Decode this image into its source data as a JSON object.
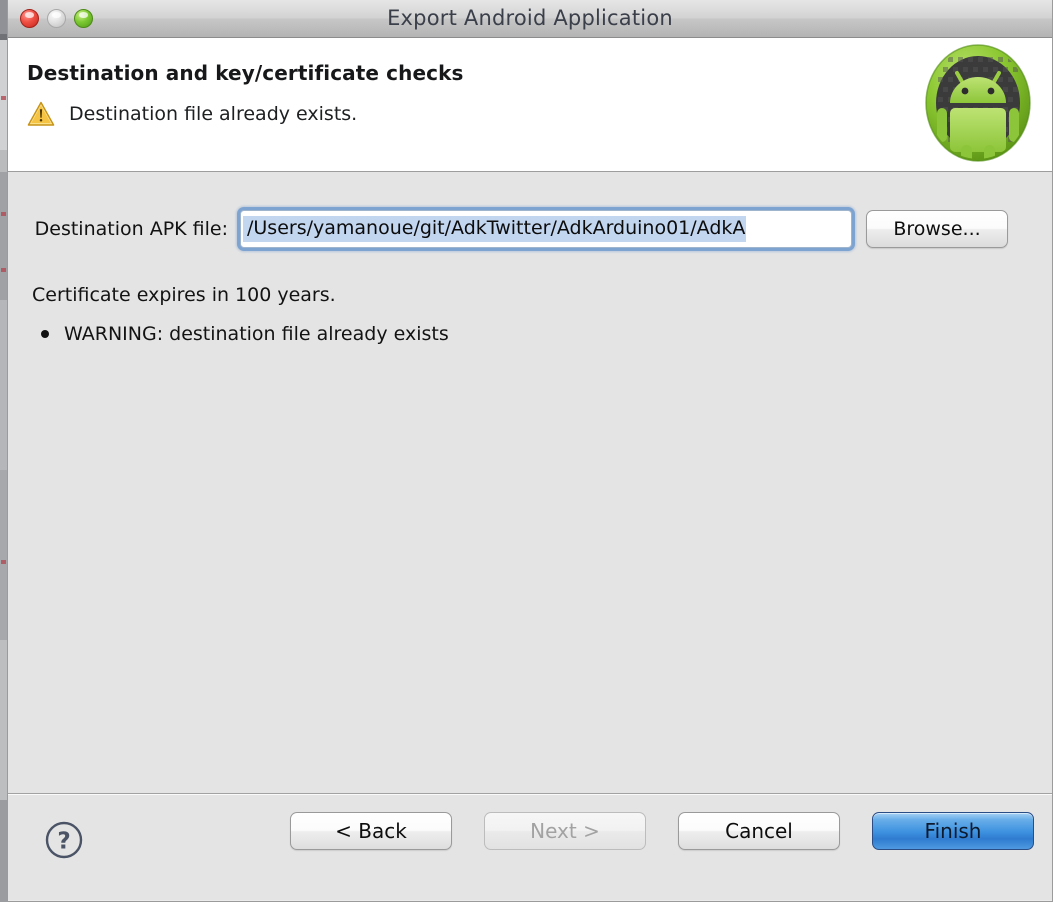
{
  "window": {
    "title": "Export Android Application",
    "controls": [
      {
        "name": "close",
        "state": "enabled"
      },
      {
        "name": "minimize",
        "state": "disabled"
      },
      {
        "name": "zoom",
        "state": "enabled"
      }
    ]
  },
  "header": {
    "title": "Destination and key/certificate checks",
    "message": "Destination file already exists.",
    "message_icon": "warning-triangle-icon",
    "brand_icon": "android-robot-icon"
  },
  "form": {
    "destination_label": "Destination APK file:",
    "destination_value": "/Users/yamanoue/git/AdkTwitter/AdkArduino01/AdkA",
    "destination_placeholder": "",
    "browse_label": "Browse..."
  },
  "status": {
    "certificate_line": "Certificate expires in 100 years.",
    "warnings": [
      "WARNING: destination file already exists"
    ]
  },
  "footer": {
    "help_icon": "help-circle-icon",
    "buttons": [
      {
        "label": "< Back",
        "name": "back-button",
        "state": "enabled",
        "style": "normal"
      },
      {
        "label": "Next >",
        "name": "next-button",
        "state": "disabled",
        "style": "normal"
      },
      {
        "label": "Cancel",
        "name": "cancel-button",
        "state": "enabled",
        "style": "normal"
      },
      {
        "label": "Finish",
        "name": "finish-button",
        "state": "enabled",
        "style": "default"
      }
    ]
  },
  "colors": {
    "accent_blue": "#3e92e0",
    "focus_ring": "#5d8fcb",
    "selection": "#c3d6f0",
    "warning_amber": "#f0a91e",
    "android_green": "#7fc22b",
    "body_bg": "#e4e4e4",
    "header_bg": "#ffffff"
  }
}
